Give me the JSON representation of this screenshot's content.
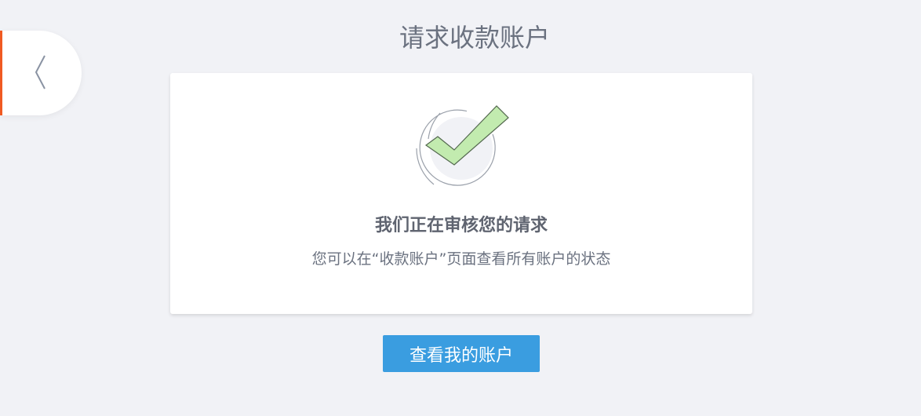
{
  "page": {
    "title": "请求收款账户"
  },
  "card": {
    "heading": "我们正在审核您的请求",
    "subtext": "您可以在“收款账户”页面查看所有账户的状态"
  },
  "actions": {
    "view_accounts_label": "查看我的账户"
  },
  "colors": {
    "background": "#f1f2f6",
    "accent_edge": "#f05a22",
    "primary": "#3a9de0",
    "check_fill": "#c2ebaf"
  },
  "icons": {
    "back": "chevron-left-icon",
    "status": "checkmark-icon"
  }
}
